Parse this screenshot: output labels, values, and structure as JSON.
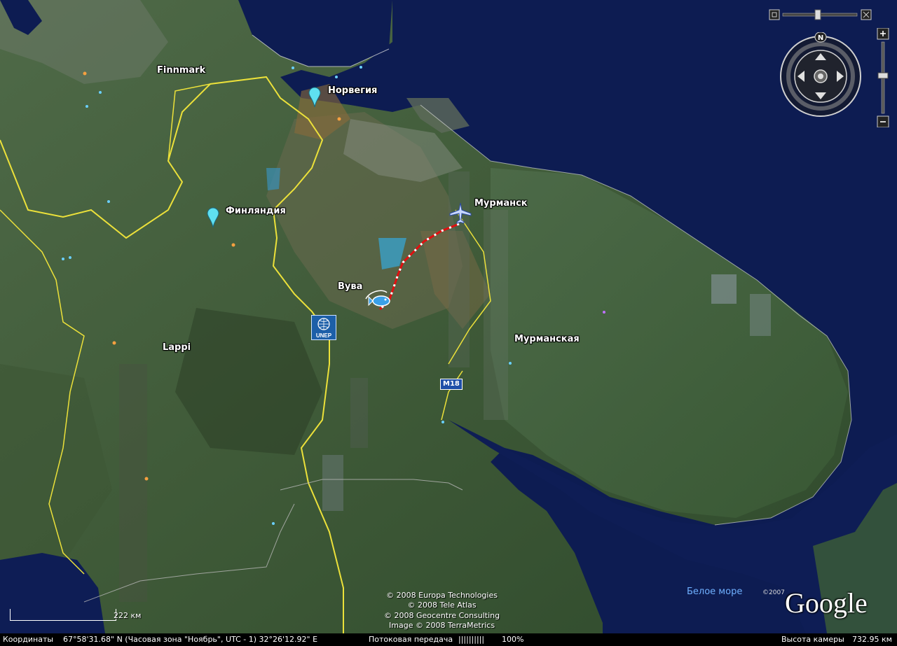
{
  "labels": {
    "finnmark": "Finnmark",
    "norway": "Норвегия",
    "finland": "Финляндия",
    "murmansk_city": "Мурманск",
    "vuva": "Вува",
    "lappi": "Lappi",
    "murmansk_region": "Мурманская",
    "white_sea": "Белое море",
    "road": "M18",
    "unep": "UNEP"
  },
  "credits": [
    "© 2008 Europa Technologies",
    "© 2008 Tele Atlas",
    "© 2008 Geocentre Consulting",
    "Image © 2008 TerraMetrics"
  ],
  "copyright_year": "©2007",
  "logo": "Google",
  "scale": {
    "label": "222 км"
  },
  "status": {
    "coords_label": "Координаты",
    "coords_value": "67°58'31.68\" N (Часовая зона \"Ноябрь\", UTC - 1)  32°26'12.92\" E",
    "streaming_label": "Потоковая передача",
    "streaming_bar": "||||||||||",
    "streaming_value": "100%",
    "altitude_label": "Высота камеры",
    "altitude_value": "732.95 км"
  },
  "nav": {
    "north_label": "N"
  },
  "icons": [
    "placemark-icon",
    "airplane-icon",
    "fishing-icon",
    "unep-icon",
    "compass-icon",
    "zoom-slider-icon"
  ],
  "colors": {
    "sea": "#0c1a4a",
    "border": "#e8e03a",
    "track": "#e01010",
    "pin": "#5fe0f0"
  }
}
